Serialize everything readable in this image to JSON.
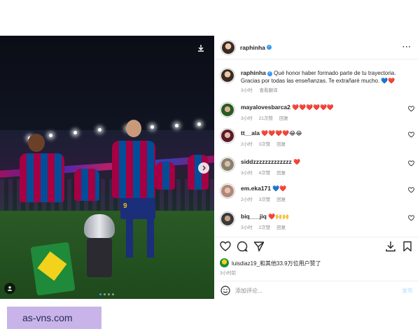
{
  "post": {
    "author": "raphinha",
    "verified": true,
    "more_label": "···",
    "caption_user": "raphinha",
    "caption_text": "Qué honor haber formado parte de tu trayectoria. Gracias por todas las enseñanzas. Te extrañaré mucho. 💙❤️",
    "caption_time": "3小时",
    "caption_translate": "查看翻译"
  },
  "comments": [
    {
      "user": "mayalovesbarca2",
      "text": "❤️❤️❤️❤️❤️❤️",
      "time": "3小时",
      "likes": "21次赞",
      "reply": "回复"
    },
    {
      "user": "tt__ala",
      "text": "❤️❤️❤️❤️😂😂",
      "time": "2小时",
      "likes": "3次赞",
      "reply": "回复"
    },
    {
      "user": "siddzzzzzzzzzzzzz",
      "text": "❤️",
      "time": "3小时",
      "likes": "4次赞",
      "reply": "回复"
    },
    {
      "user": "em.eka171",
      "text": "💙❤️",
      "time": "2小时",
      "likes": "3次赞",
      "reply": "回复"
    },
    {
      "user": "biq___jiq",
      "text": "❤️🙌🙌",
      "time": "3小时",
      "likes": "2次赞",
      "reply": "回复"
    }
  ],
  "likes": {
    "text": "luisdiaz19_和其他33.9万位用户赞了"
  },
  "post_time": "3小时前",
  "composer": {
    "placeholder": "添加评论...",
    "post_label": "发布"
  },
  "photo": {
    "slide_count": 4,
    "active_slide": 1,
    "jersey_number": "9"
  },
  "watermark": "as-vns.com",
  "colors": {
    "verified": "#3897f0",
    "heart": "#ed4956",
    "meta_gray": "#8e8e8e",
    "barca_blue": "#004d98",
    "barca_red": "#a50044"
  },
  "icons": [
    "save-icon",
    "chevron-right-icon",
    "user-tag-icon",
    "heart-icon",
    "comment-icon",
    "share-icon",
    "download-icon",
    "bookmark-icon",
    "emoji-icon",
    "more-icon"
  ]
}
